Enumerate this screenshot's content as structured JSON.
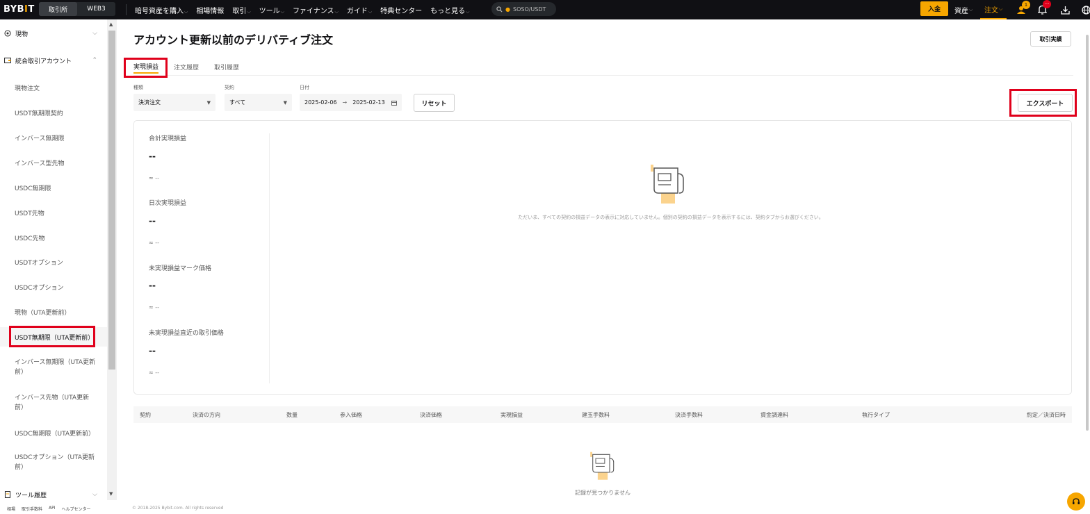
{
  "topbar": {
    "logo": {
      "main": "BYB",
      "dot": "I",
      "tail": "T"
    },
    "segments": [
      "取引所",
      "WEB3"
    ],
    "nav": [
      {
        "label": "暗号資産を購入",
        "caret": true
      },
      {
        "label": "相場情報",
        "caret": false
      },
      {
        "label": "取引",
        "caret": true
      },
      {
        "label": "ツール",
        "caret": true
      },
      {
        "label": "ファイナンス",
        "caret": true
      },
      {
        "label": "ガイド",
        "caret": true
      },
      {
        "label": "特典センター",
        "caret": false
      },
      {
        "label": "もっと見る",
        "caret": true
      }
    ],
    "search_text": "SOSO/USDT",
    "deposit": "入金",
    "assets": "資産",
    "orders": "注文",
    "user_badge": "1",
    "notif_badge": "···",
    "accent": "#f7a600"
  },
  "sidebar": {
    "sections": [
      {
        "label": "現物",
        "icon": "spot-icon"
      },
      {
        "label": "統合取引アカウント",
        "icon": "wallet-icon"
      }
    ],
    "items": [
      "現物注文",
      "USDT無期限契約",
      "インバース無期限",
      "インバース型先物",
      "USDC無期限",
      "USDT先物",
      "USDC先物",
      "USDTオプション",
      "USDCオプション",
      "現物（UTA更新前）",
      "USDT無期限（UTA更新前）",
      "インバース無期限（UTA更新前）",
      "インバース先物（UTA更新前）",
      "USDC無期限（UTA更新前）",
      "USDCオプション（UTA更新前）"
    ],
    "bottom_section": "ツール履歴",
    "footer_links": [
      "相場",
      "取引手数料",
      "API",
      "ヘルプセンター"
    ]
  },
  "main": {
    "title": "アカウント更新以前のデリバティブ注文",
    "history_button": "取引実績",
    "tabs": [
      "実現損益",
      "注文履歴",
      "取引履歴"
    ],
    "filters": {
      "type_label": "種類",
      "type_value": "決済注文",
      "contract_label": "契約",
      "contract_value": "すべて",
      "date_label": "日付",
      "date_from": "2025-02-06",
      "date_arrow": "→",
      "date_to": "2025-02-13"
    },
    "reset": "リセット",
    "export": "エクスポート",
    "stats": [
      {
        "label": "合計実現損益",
        "value": "--",
        "approx": "≈ --"
      },
      {
        "label": "日次実現損益",
        "value": "--",
        "approx": "≈ --"
      },
      {
        "label": "未実現損益マーク価格",
        "value": "--",
        "approx": "≈ --"
      },
      {
        "label": "未実現損益直近の取引価格",
        "value": "--",
        "approx": "≈ --"
      }
    ],
    "empty_message": "ただいま、すべての契約の損益データの表示に対応していません。個別の契約の損益データを表示するには、契約タブからお選びください。",
    "table_headers": [
      "契約",
      "決済の方向",
      "数量",
      "参入価格",
      "決済価格",
      "実現損益",
      "建玉手数料",
      "決済手数料",
      "資金調達料",
      "執行タイプ",
      "約定／決済日時"
    ],
    "no_records": "記録が見つかりません",
    "copyright": "© 2018-2025 Bybit.com. All rights reserved"
  }
}
